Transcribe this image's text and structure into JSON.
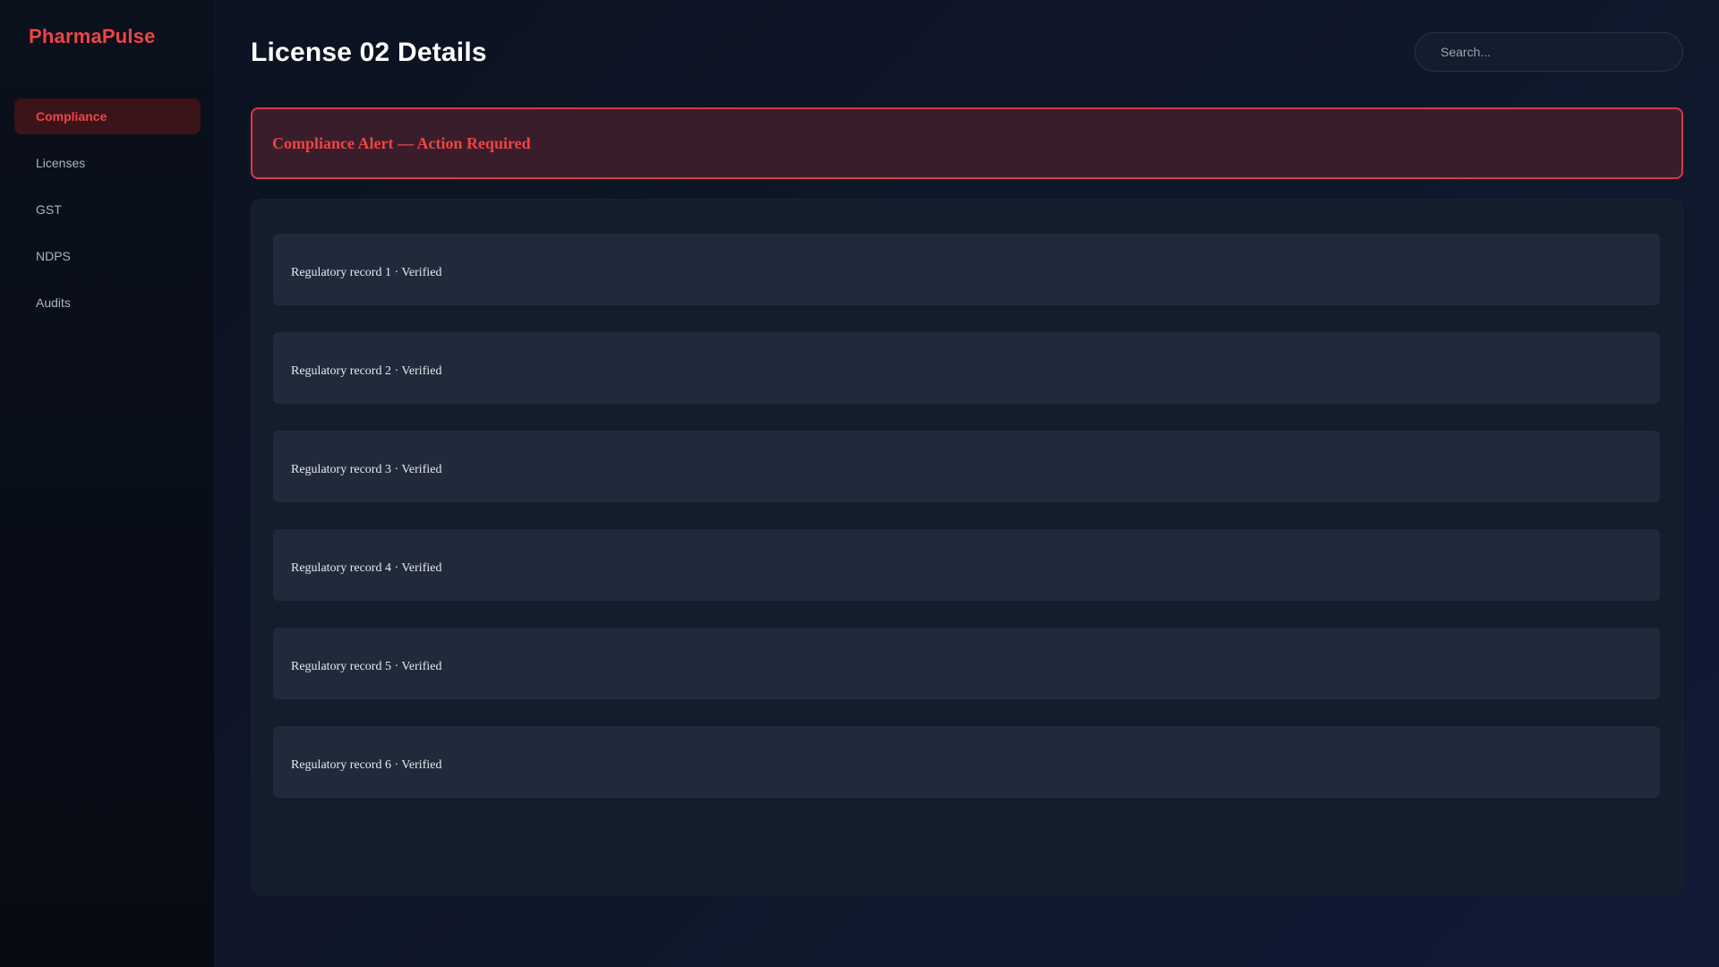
{
  "app": {
    "name": "PharmaPulse"
  },
  "sidebar": {
    "items": [
      {
        "label": "Compliance",
        "active": true
      },
      {
        "label": "Licenses",
        "active": false
      },
      {
        "label": "GST",
        "active": false
      },
      {
        "label": "NDPS",
        "active": false
      },
      {
        "label": "Audits",
        "active": false
      }
    ]
  },
  "header": {
    "title": "License 02 Details",
    "search_placeholder": "Search..."
  },
  "alert": {
    "text": "Compliance Alert — Action Required"
  },
  "records": [
    {
      "text": "Regulatory record 1 · Verified"
    },
    {
      "text": "Regulatory record 2 · Verified"
    },
    {
      "text": "Regulatory record 3 · Verified"
    },
    {
      "text": "Regulatory record 4 · Verified"
    },
    {
      "text": "Regulatory record 5 · Verified"
    },
    {
      "text": "Regulatory record 6 · Verified"
    }
  ],
  "colors": {
    "accent": "#ef4444",
    "background": "#0f172a",
    "sidebar": "#080d17",
    "alert_background": "#3a1d2b",
    "record_background": "#202a3a"
  }
}
